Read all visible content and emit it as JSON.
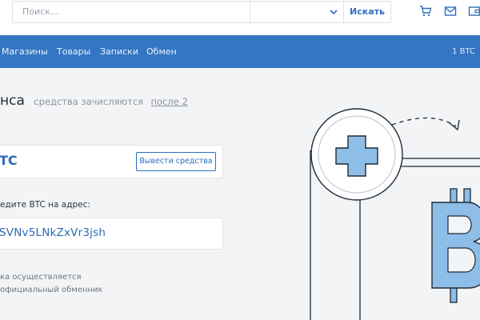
{
  "search": {
    "placeholder": "Поиск...",
    "button": "Искать"
  },
  "nav": {
    "items": [
      "Магазины",
      "Товары",
      "Записки",
      "Обмен"
    ],
    "right": "1 BTC"
  },
  "main": {
    "heading": "нса",
    "heading_sub": "средства зачисляются",
    "heading_link": "после 2",
    "balance": "TC",
    "withdraw": "Вывести средства",
    "address_label": "едите BTC на адрес:",
    "address": "SVNv5LNkZxVr3jsh",
    "note_line1": "ка осуществляется",
    "note_line2": "официальный обменник"
  },
  "colors": {
    "accent": "#3476c3",
    "link": "#2c6fbf"
  }
}
